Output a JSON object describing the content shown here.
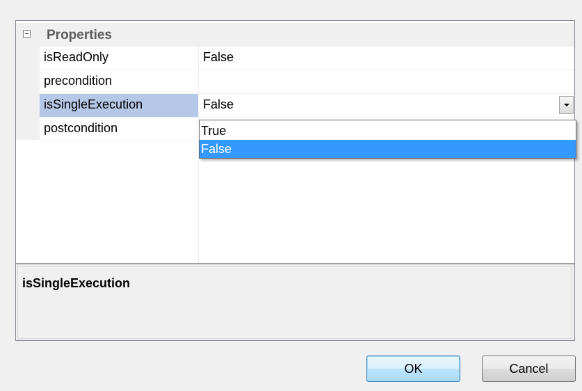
{
  "property_grid": {
    "category": {
      "label": "Properties",
      "icon": "collapse-minus-icon"
    },
    "rows": [
      {
        "name": "isReadOnly",
        "value": "False"
      },
      {
        "name": "precondition",
        "value": ""
      },
      {
        "name": "isSingleExecution",
        "value": "False",
        "selected": true
      },
      {
        "name": "postcondition",
        "value": ""
      }
    ],
    "dropdown": {
      "icon": "dropdown-arrow-icon",
      "options": [
        "True",
        "False"
      ],
      "highlighted": "False"
    }
  },
  "help_pane": {
    "title": "isSingleExecution"
  },
  "buttons": {
    "ok_label": "OK",
    "cancel_label": "Cancel"
  },
  "colors": {
    "selection_row": "#b5c8e8",
    "list_highlight": "#3399ff",
    "background": "#f0f0f0"
  }
}
